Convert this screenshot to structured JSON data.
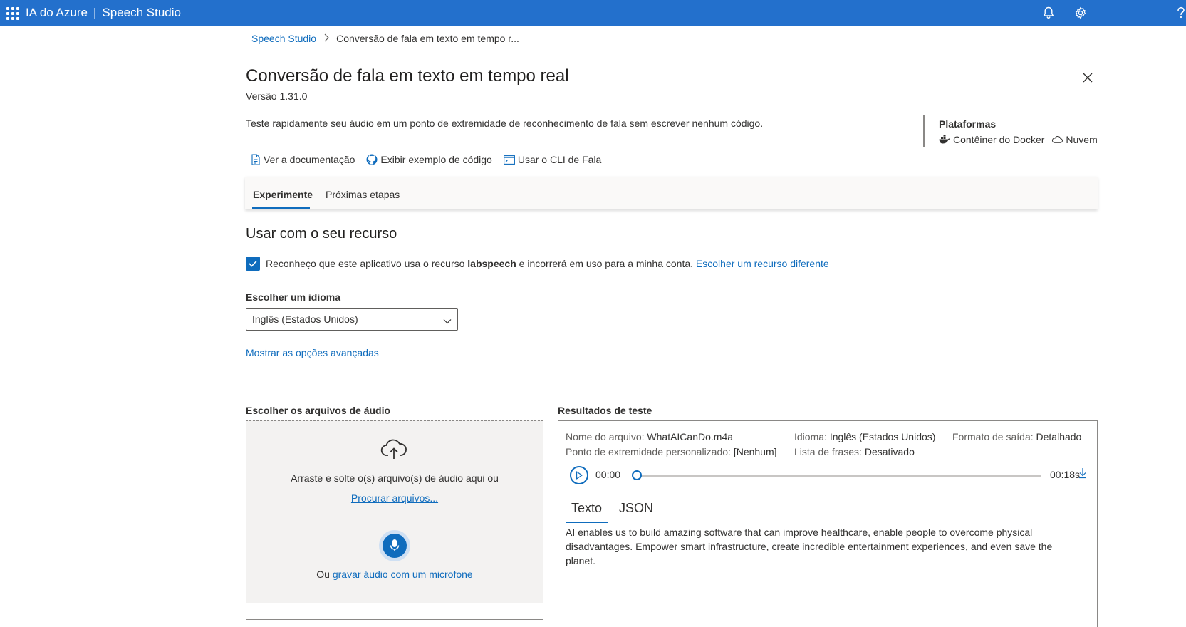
{
  "topbar": {
    "brand_left": "IA do Azure",
    "separator": "|",
    "brand_right": "Speech Studio",
    "icons": [
      "app-launcher-icon",
      "bell-icon",
      "gear-icon",
      "help-icon"
    ],
    "accent_color": "#2370cc"
  },
  "breadcrumb": {
    "root": "Speech Studio",
    "current": "Conversão de fala em texto em tempo r..."
  },
  "header": {
    "title": "Conversão de fala em texto em tempo real",
    "version": "Versão 1.31.0",
    "description": "Teste rapidamente seu áudio em um ponto de extremidade de reconhecimento de fala sem escrever nenhum código."
  },
  "platforms": {
    "title": "Plataformas",
    "items": [
      {
        "label": "Contêiner do Docker",
        "icon": "docker-icon"
      },
      {
        "label": "Nuvem",
        "icon": "cloud-icon"
      }
    ]
  },
  "links": [
    {
      "label": "Ver a documentação",
      "icon": "document-icon"
    },
    {
      "label": "Exibir exemplo de código",
      "icon": "github-icon"
    },
    {
      "label": "Usar o CLI de Fala",
      "icon": "cli-icon"
    }
  ],
  "tabs": [
    {
      "label": "Experimente",
      "active": true
    },
    {
      "label": "Próximas etapas",
      "active": false
    }
  ],
  "resource": {
    "section_title": "Usar com o seu recurso",
    "ack_checked": true,
    "ack_prefix": "Reconheço que este aplicativo usa o recurso",
    "resource_name": "labspeech",
    "ack_suffix": "e incorrerá em uso para a minha conta.",
    "change_link": "Escolher um recurso diferente"
  },
  "language": {
    "label": "Escolher um idioma",
    "selected": "Inglês (Estados Unidos)",
    "advanced_link": "Mostrar as opções avançadas"
  },
  "files": {
    "label": "Escolher os arquivos de áudio",
    "drop_text": "Arraste e solte o(s) arquivo(s) de áudio aqui ou",
    "browse_link": "Procurar arquivos...",
    "or_text": "Ou",
    "record_link": "gravar áudio com um microfone"
  },
  "results": {
    "label": "Resultados de teste",
    "file_name_label": "Nome do arquivo:",
    "file_name": "WhatAICanDo.m4a",
    "language_label": "Idioma:",
    "language": "Inglês (Estados Unidos)",
    "format_label": "Formato de saída:",
    "format": "Detalhado",
    "endpoint_label": "Ponto de extremidade personalizado:",
    "endpoint": "[Nenhum]",
    "phrase_label": "Lista de frases:",
    "phrase": "Desativado",
    "player": {
      "current_time": "00:00",
      "total_time": "00:18s",
      "progress": 0
    },
    "tabs": [
      {
        "label": "Texto",
        "active": true
      },
      {
        "label": "JSON",
        "active": false
      }
    ],
    "transcript": "AI enables us to build amazing software that can improve healthcare, enable people to overcome physical disadvantages. Empower smart infrastructure, create incredible entertainment experiences, and even save the planet."
  }
}
